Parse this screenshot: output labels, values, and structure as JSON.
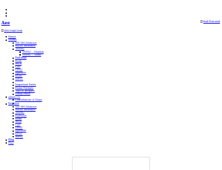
{
  "header": {
    "brand": "Aee",
    "find_post_alt": "find Post mid",
    "logo_alt": "Aee Logo Icon"
  },
  "nav": {
    "home": "Home",
    "exams": "Exams",
    "exams_items": {
      "md_ms_distance": "MD MS Distance",
      "mdss_entrance": "MDSS Entrance",
      "tnpsc": "TNPSC",
      "tnpsc_sub": {
        "english": "TNPSC – English",
        "tamil": "TNPSC – Tamil"
      },
      "railways": "Railways",
      "bank": "Bank",
      "mca": "MCA",
      "cat": "CAT",
      "upsc": "UPSC",
      "aptitude": "Aptitude",
      "ktsc": "KTSC",
      "mpsc": "MPSC"
    },
    "important_dates": "Important Dates",
    "exam_formats": "Exam Formats",
    "tips_to_prepare": "Tips to prepare",
    "study_plans": "Study Plans",
    "about_us": "About Us",
    "about_items": {
      "contributors": "Contributors & Team"
    },
    "register": "Register",
    "register_items": {
      "md_ms_distance": "MD MS Distance",
      "mdss_entrance": "MDSS Entrance",
      "tnpsc": "TNPSC",
      "railways": "Railways",
      "bank": "Bank",
      "mca": "MCA",
      "cat": "CAT",
      "upsc": "UPSC",
      "aptitude": "Aptitude",
      "ktsc": "KTSC",
      "mpsc": "MPSC"
    },
    "blog": "Blog",
    "faq": "FAQ"
  }
}
